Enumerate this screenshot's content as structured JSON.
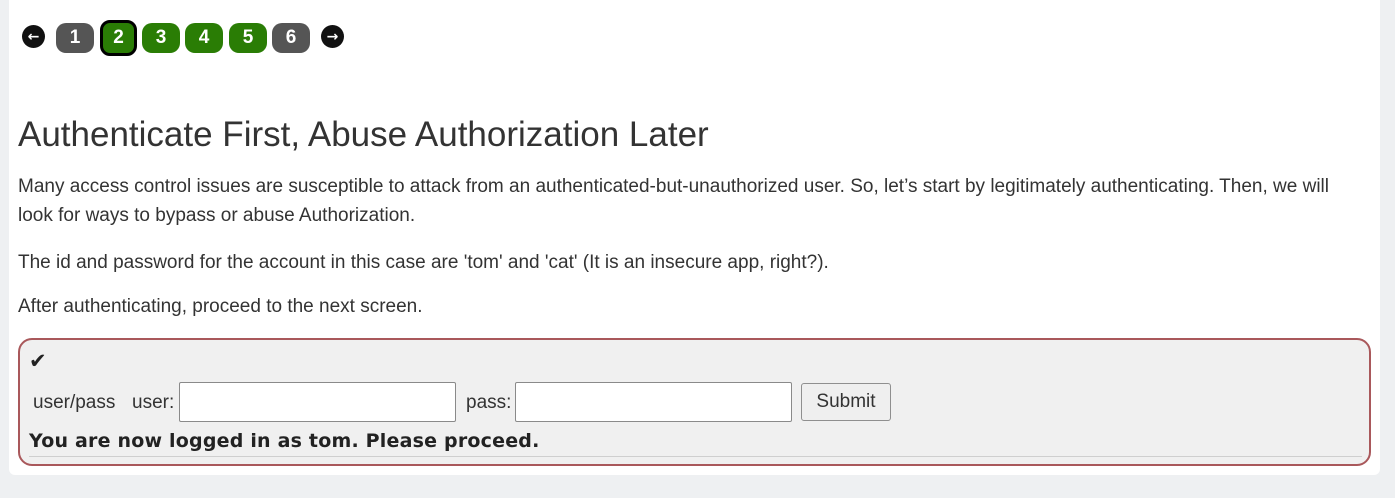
{
  "pager": {
    "prev_icon": "←",
    "next_icon": "→",
    "pages": [
      {
        "label": "1",
        "status": "grey"
      },
      {
        "label": "2",
        "status": "green",
        "current": true
      },
      {
        "label": "3",
        "status": "green"
      },
      {
        "label": "4",
        "status": "green"
      },
      {
        "label": "5",
        "status": "green"
      },
      {
        "label": "6",
        "status": "grey"
      }
    ],
    "colors": {
      "grey": "#555555",
      "green": "#2a7d05"
    }
  },
  "lesson": {
    "title": "Authenticate First, Abuse Authorization Later",
    "paragraph1": "Many access control issues are susceptible to attack from an authenticated-but-unauthorized user. So, let’s start by legitimately authenticating. Then, we will look for ways to bypass or abuse Authorization.",
    "paragraph2": "The id and password for the account in this case are 'tom' and 'cat' (It is an insecure app, right?).",
    "paragraph3": "After authenticating, proceed to the next screen."
  },
  "attack_form": {
    "status_icon": "✔",
    "title": "user/pass",
    "user_label": "user:",
    "user_value": "",
    "pass_label": "pass:",
    "pass_value": "",
    "submit_label": "Submit",
    "feedback": "You are now logged in as tom. Please proceed.",
    "border_color": "#a9585b"
  }
}
